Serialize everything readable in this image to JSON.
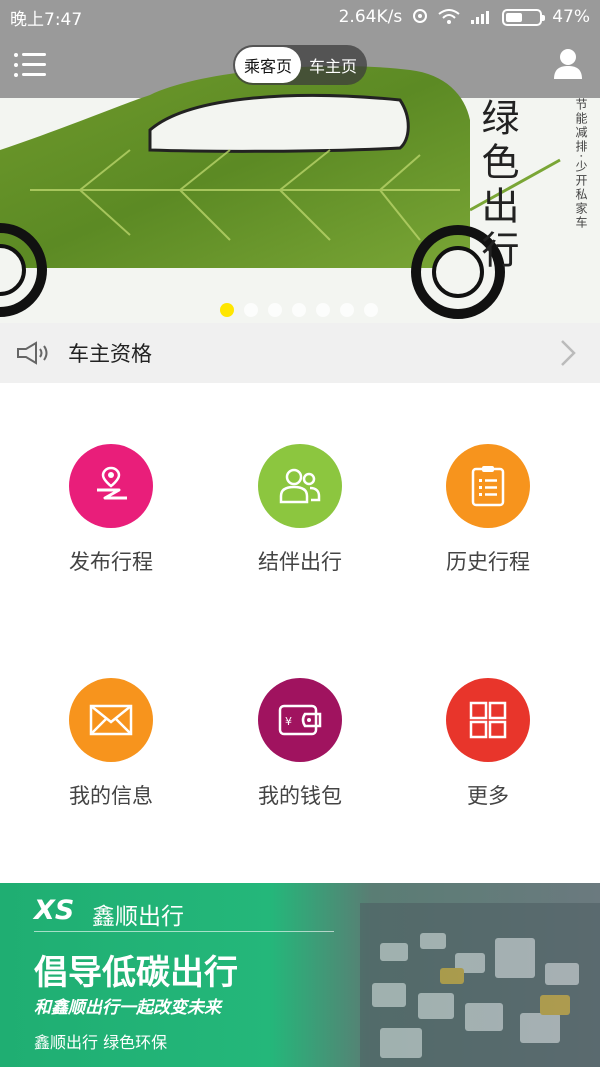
{
  "status_bar": {
    "time": "晚上7:47",
    "speed": "2.64K/s",
    "battery": "47%",
    "battery_level": 0.47
  },
  "header": {
    "segments": [
      "乘客页",
      "车主页"
    ],
    "active_segment": "乘客页",
    "menu_icon": "menu-icon",
    "user_icon": "user-icon"
  },
  "hero": {
    "slogan_big": "绿色出行",
    "slogan_small": "节能减排·少开私家车",
    "slide_count": 7,
    "active_slide": 1,
    "accent": "#ffe600"
  },
  "notice": {
    "label": "车主资格",
    "icon": "megaphone-icon"
  },
  "grid": {
    "items": [
      {
        "label": "发布行程",
        "color": "#e91e7a",
        "icon": "route-pin-icon"
      },
      {
        "label": "结伴出行",
        "color": "#8cc63f",
        "icon": "people-icon"
      },
      {
        "label": "历史行程",
        "color": "#f7941d",
        "icon": "clipboard-icon"
      },
      {
        "label": "我的信息",
        "color": "#f7941d",
        "icon": "envelope-icon"
      },
      {
        "label": "我的钱包",
        "color": "#a0135f",
        "icon": "wallet-icon"
      },
      {
        "label": "更多",
        "color": "#e8352b",
        "icon": "grid-icon"
      }
    ]
  },
  "banner": {
    "logo": "XS",
    "brand": "鑫顺出行",
    "headline": "倡导低碳出行",
    "subline": "和鑫顺出行一起改变未来",
    "tagline": "鑫顺出行  绿色环保"
  }
}
